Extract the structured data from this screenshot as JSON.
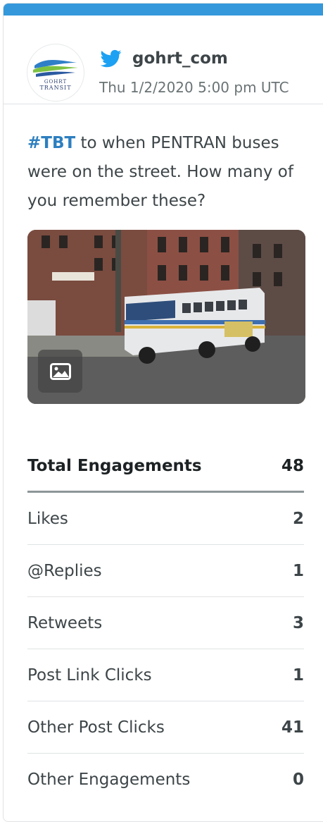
{
  "card": {
    "accent_color": "#3498db",
    "avatar": {
      "line1": "GOHRT",
      "line2": "TRANSIT"
    },
    "network_icon": "twitter-icon",
    "handle": "gohrt_com",
    "timestamp": "Thu 1/2/2020 5:00 pm UTC"
  },
  "post": {
    "hashtag": "#TBT",
    "text": " to when PENTRAN buses were on the street. How many of you remember these?",
    "hashtag_color": "#2d7fbf",
    "media_icon": "image-icon"
  },
  "stats": {
    "header_label": "Total Engagements",
    "header_value": "48",
    "rows": [
      {
        "label": "Likes",
        "value": "2"
      },
      {
        "label": "@Replies",
        "value": "1"
      },
      {
        "label": "Retweets",
        "value": "3"
      },
      {
        "label": "Post Link Clicks",
        "value": "1"
      },
      {
        "label": "Other Post Clicks",
        "value": "41"
      },
      {
        "label": "Other Engagements",
        "value": "0"
      }
    ]
  }
}
